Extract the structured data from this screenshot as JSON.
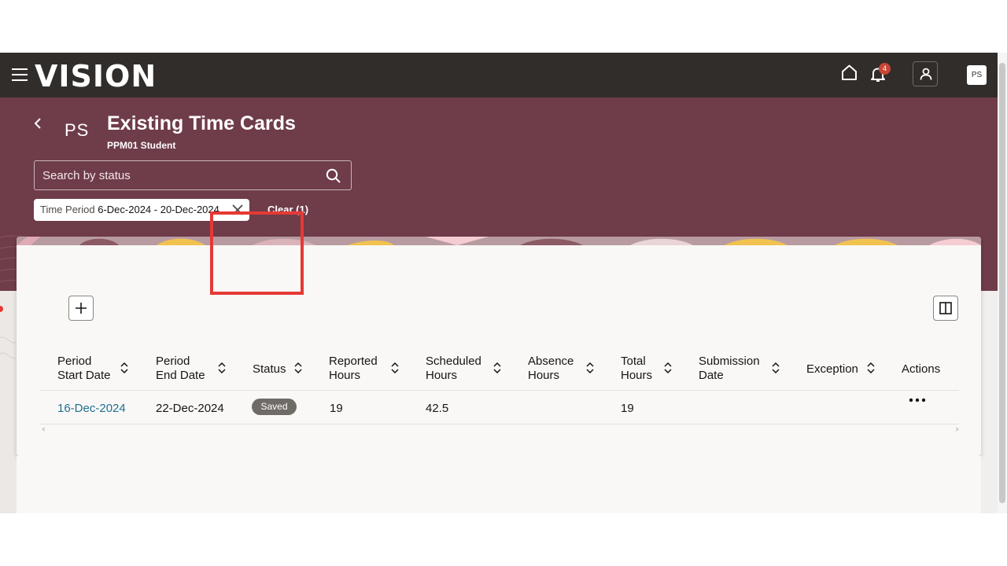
{
  "app": {
    "logo": "VISION",
    "notifications_count": "4",
    "avatar_initials": "PS"
  },
  "header": {
    "initials": "PS",
    "title": "Existing Time Cards",
    "subtitle": "PPM01 Student"
  },
  "search": {
    "placeholder": "Search by status"
  },
  "filter": {
    "label": "Time Period",
    "value": "6-Dec-2024 - 20-Dec-2024",
    "clear_label": "Clear (1)"
  },
  "table": {
    "columns": [
      {
        "line1": "Period",
        "line2": "Start Date"
      },
      {
        "line1": "Period",
        "line2": "End Date"
      },
      {
        "line1": "Status",
        "line2": ""
      },
      {
        "line1": "Reported",
        "line2": "Hours"
      },
      {
        "line1": "Scheduled",
        "line2": "Hours"
      },
      {
        "line1": "Absence",
        "line2": "Hours"
      },
      {
        "line1": "Total",
        "line2": "Hours"
      },
      {
        "line1": "Submission",
        "line2": "Date"
      },
      {
        "line1": "Exception",
        "line2": ""
      },
      {
        "line1": "Actions",
        "line2": ""
      }
    ],
    "rows": [
      {
        "start_date": "16-Dec-2024",
        "end_date": "22-Dec-2024",
        "status": "Saved",
        "reported_hours": "19",
        "scheduled_hours": "42.5",
        "absence_hours": "",
        "total_hours": "19",
        "submission_date": "",
        "exception": ""
      }
    ]
  },
  "colors": {
    "topbar": "#312d2a",
    "header_band": "#6f3c4a",
    "link": "#1e6f93",
    "status_pill": "#6f6b67",
    "highlight": "#e53935",
    "badge": "#c74634"
  }
}
